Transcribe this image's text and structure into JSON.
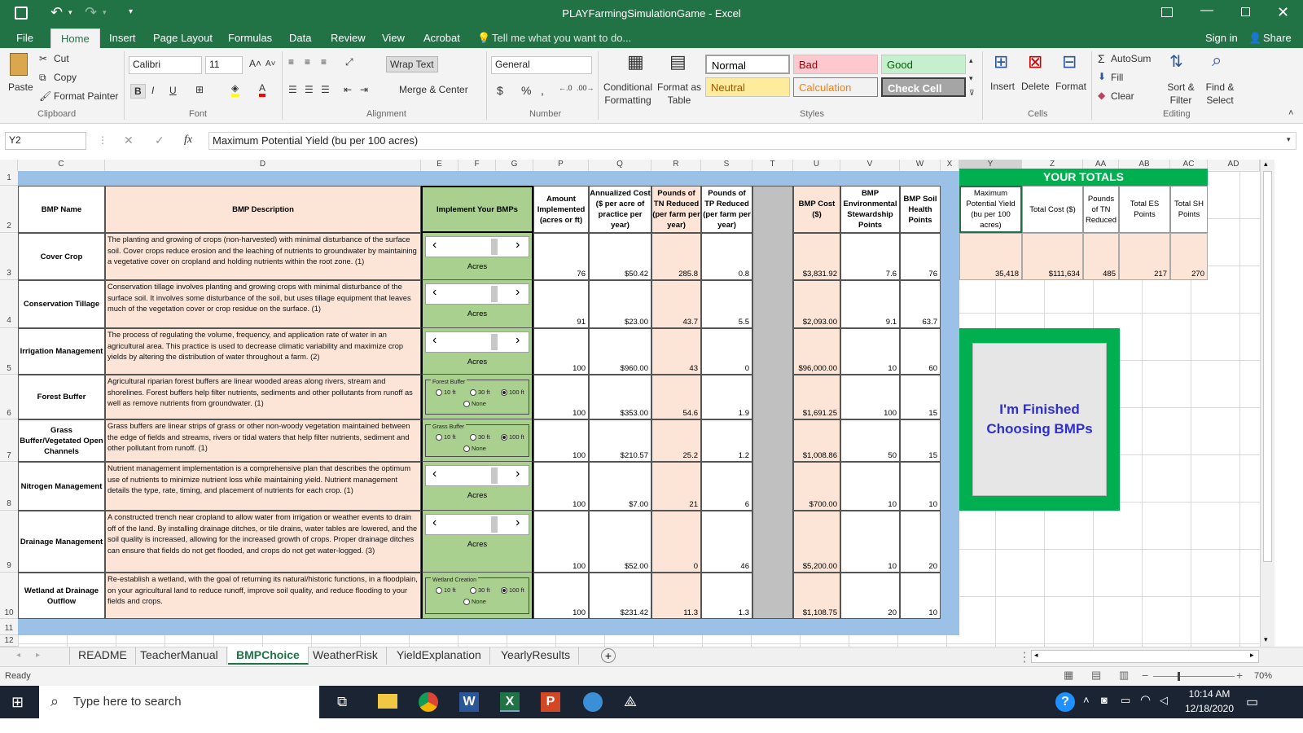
{
  "window": {
    "title": "PLAYFarmingSimulationGame - Excel"
  },
  "ribbon_tabs": [
    "File",
    "Home",
    "Insert",
    "Page Layout",
    "Formulas",
    "Data",
    "Review",
    "View",
    "Acrobat"
  ],
  "tell_me": "Tell me what you want to do...",
  "account": {
    "sign_in": "Sign in",
    "share": "Share"
  },
  "clipboard": {
    "paste": "Paste",
    "cut": "Cut",
    "copy": "Copy",
    "format_painter": "Format Painter",
    "label": "Clipboard"
  },
  "font": {
    "name": "Calibri",
    "size": "11",
    "label": "Font"
  },
  "alignment": {
    "wrap": "Wrap Text",
    "merge": "Merge & Center",
    "label": "Alignment"
  },
  "number": {
    "format": "General",
    "label": "Number"
  },
  "styles": {
    "conditional": "Conditional Formatting",
    "format_table": "Format as Table",
    "normal": "Normal",
    "bad": "Bad",
    "good": "Good",
    "neutral": "Neutral",
    "calculation": "Calculation",
    "check": "Check Cell",
    "label": "Styles"
  },
  "cells": {
    "insert": "Insert",
    "delete": "Delete",
    "format": "Format",
    "label": "Cells"
  },
  "editing": {
    "autosum": "AutoSum",
    "fill": "Fill",
    "clear": "Clear",
    "sort": "Sort & Filter",
    "find": "Find & Select",
    "label": "Editing"
  },
  "formula_bar": {
    "name_box": "Y2",
    "fx": "fx",
    "content": "Maximum Potential Yield (bu per 100 acres)"
  },
  "columns": [
    "C",
    "D",
    "E",
    "F",
    "G",
    "P",
    "Q",
    "R",
    "S",
    "T",
    "U",
    "V",
    "W",
    "X",
    "Y",
    "Z",
    "AA",
    "AB",
    "AC",
    "AD"
  ],
  "rows": [
    "1",
    "2",
    "3",
    "4",
    "5",
    "6",
    "7",
    "8",
    "9",
    "10",
    "11",
    "12"
  ],
  "headers": {
    "bmp_name": "BMP Name",
    "bmp_desc": "BMP Description",
    "implement": "Implement Your BMPs",
    "amount": "Amount Implemented (acres or ft)",
    "annual_cost": "Annualized Cost ($ per acre of practice per year)",
    "tn": "Pounds of TN Reduced (per farm per year)",
    "tp": "Pounds of TP Reduced (per farm per year)",
    "bmp_cost": "BMP Cost ($)",
    "es": "BMP Environmental Stewardship Points",
    "sh": "BMP Soil Health Points"
  },
  "bmps": [
    {
      "name": "Cover Crop",
      "desc": "The planting and growing of crops (non-harvested) with minimal disturbance of the surface soil. Cover crops reduce erosion and the leaching of nutrients to groundwater by maintaining a vegetative cover on cropland and holding nutrients within the root zone. (1)",
      "control": "Acres",
      "amount": "76",
      "cost": "$50.42",
      "tn": "285.8",
      "tp": "0.8",
      "bmp_cost": "$3,831.92",
      "es": "7.6",
      "sh": "76"
    },
    {
      "name": "Conservation Tillage",
      "desc": "Conservation tillage involves planting and growing crops with minimal disturbance of the surface soil. It involves some disturbance of the soil, but uses tillage equipment that leaves much of the vegetation cover or crop residue on the surface. (1)",
      "control": "Acres",
      "amount": "91",
      "cost": "$23.00",
      "tn": "43.7",
      "tp": "5.5",
      "bmp_cost": "$2,093.00",
      "es": "9.1",
      "sh": "63.7"
    },
    {
      "name": "Irrigation Management",
      "desc": "The process of regulating the volume, frequency, and application rate of water in an agricultural area. This practice is used to decrease climatic variability and maximize crop yields by altering the distribution of water throughout a farm. (2)",
      "control": "Acres",
      "amount": "100",
      "cost": "$960.00",
      "tn": "43",
      "tp": "0",
      "bmp_cost": "$96,000.00",
      "es": "10",
      "sh": "60"
    },
    {
      "name": "Forest Buffer",
      "desc": "Agricultural riparian forest buffers are linear wooded areas along rivers, stream and shorelines. Forest buffers help filter nutrients, sediments and other pollutants from runoff as well as remove nutrients from groundwater. (1)",
      "radio_title": "Forest Buffer",
      "amount": "100",
      "cost": "$353.00",
      "tn": "54.6",
      "tp": "1.9",
      "bmp_cost": "$1,691.25",
      "es": "100",
      "sh": "15"
    },
    {
      "name": "Grass Buffer/Vegetated Open Channels",
      "desc": "Grass buffers are linear strips of grass or other non-woody vegetation maintained between the edge of fields and streams, rivers or tidal waters that help filter nutrients, sediment and other pollutant from runoff. (1)",
      "radio_title": "Grass Buffer",
      "amount": "100",
      "cost": "$210.57",
      "tn": "25.2",
      "tp": "1.2",
      "bmp_cost": "$1,008.86",
      "es": "50",
      "sh": "15"
    },
    {
      "name": "Nitrogen Management",
      "desc": "Nutrient management implementation is a comprehensive plan that describes the optimum use of nutrients to minimize nutrient loss while maintaining yield. Nutrient management details the type, rate, timing, and placement of nutrients for each crop. (1)",
      "control": "Acres",
      "amount": "100",
      "cost": "$7.00",
      "tn": "21",
      "tp": "6",
      "bmp_cost": "$700.00",
      "es": "10",
      "sh": "10"
    },
    {
      "name": "Drainage Management",
      "desc": "A constructed trench near cropland to allow water from irrigation or weather events to drain off of the land. By installing drainage ditches, or tile drains, water tables are lowered, and the soil quality is increased, allowing for the increased growth of crops. Proper drainage ditches can ensure that fields do not get flooded, and crops do not get water-logged. (3)",
      "control": "Acres",
      "amount": "100",
      "cost": "$52.00",
      "tn": "0",
      "tp": "46",
      "bmp_cost": "$5,200.00",
      "es": "10",
      "sh": "20"
    },
    {
      "name": "Wetland at Drainage Outflow",
      "desc": "Re-establish a wetland, with the goal of returning its natural/historic functions, in a floodplain, on your agricultural land to reduce runoff, improve soil quality, and reduce flooding to your fields and crops.",
      "radio_title": "Wetland Creation",
      "amount": "100",
      "cost": "$231.42",
      "tn": "11.3",
      "tp": "1.3",
      "bmp_cost": "$1,108.75",
      "es": "20",
      "sh": "10"
    }
  ],
  "radio_options": {
    "a": "10 ft",
    "b": "30 ft",
    "c": "100 ft",
    "d": "None"
  },
  "totals": {
    "title": "YOUR TOTALS",
    "h_yield": "Maximum Potential Yield (bu per 100 acres)",
    "h_cost": "Total Cost ($)",
    "h_tn": "Pounds of TN Reduced",
    "h_es": "Total ES Points",
    "h_sh": "Total SH Points",
    "yield": "35,418",
    "cost": "$111,634",
    "tn": "485",
    "es": "217",
    "sh": "270"
  },
  "finish_button": "I'm Finished Choosing BMPs",
  "sheets": [
    "README",
    "TeacherManual",
    "BMPChoice",
    "WeatherRisk",
    "YieldExplanation",
    "YearlyResults"
  ],
  "active_sheet": "BMPChoice",
  "status": {
    "ready": "Ready",
    "zoom": "70%"
  },
  "taskbar": {
    "search": "Type here to search",
    "time": "10:14 AM",
    "date": "12/18/2020"
  },
  "colors": {
    "excel_green": "#217346",
    "peach": "#fce4d6",
    "light_green": "#a9d08e",
    "blue_band": "#9bc2e6",
    "bright_green": "#00b050",
    "finish_text": "#2f2fd0"
  }
}
